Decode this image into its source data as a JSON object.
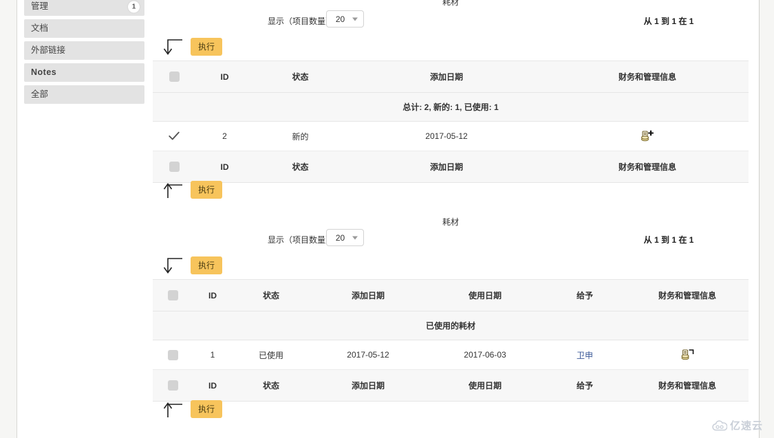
{
  "sidebar": {
    "items": [
      {
        "label": "管理",
        "badge": "1",
        "bold": false
      },
      {
        "label": "文档",
        "badge": "",
        "bold": false
      },
      {
        "label": "外部链接",
        "badge": "",
        "bold": false
      },
      {
        "label": "Notes",
        "badge": "",
        "bold": true
      },
      {
        "label": "全部",
        "badge": "",
        "bold": false
      }
    ]
  },
  "section_top": {
    "title": "耗材",
    "show_label": "显示（项目数量）",
    "page_size": "20",
    "range_text": "从 1 到 1 在 1",
    "exec_label": "执行",
    "summary": "总计: 2, 新的: 1, 已使用: 1",
    "columns": [
      "",
      "ID",
      "状态",
      "添加日期",
      "财务和管理信息"
    ],
    "rows": [
      {
        "checked": true,
        "id": "2",
        "status": "新的",
        "added": "2017-05-12",
        "finance_icon": "money-add-icon"
      }
    ],
    "exec_label_bottom": "执行"
  },
  "section_bottom": {
    "title": "耗材",
    "show_label": "显示（项目数量）",
    "page_size": "20",
    "range_text": "从 1 到 1 在 1",
    "exec_label": "执行",
    "caption": "已使用的耗材",
    "columns": [
      "",
      "ID",
      "状态",
      "添加日期",
      "使用日期",
      "给予",
      "财务和管理信息"
    ],
    "rows": [
      {
        "checked": false,
        "id": "1",
        "status": "已使用",
        "added": "2017-05-12",
        "used": "2017-06-03",
        "given_to": "卫申",
        "finance_icon": "money-edit-icon"
      }
    ],
    "exec_label_bottom": "执行"
  },
  "watermark": {
    "text": "亿速云",
    "icon": "cloud-icon"
  },
  "colors": {
    "accent": "#f7c45c",
    "link": "#3b5998",
    "sidebar_item": "#e3e3e3",
    "table_head": "#f7f7f7"
  }
}
